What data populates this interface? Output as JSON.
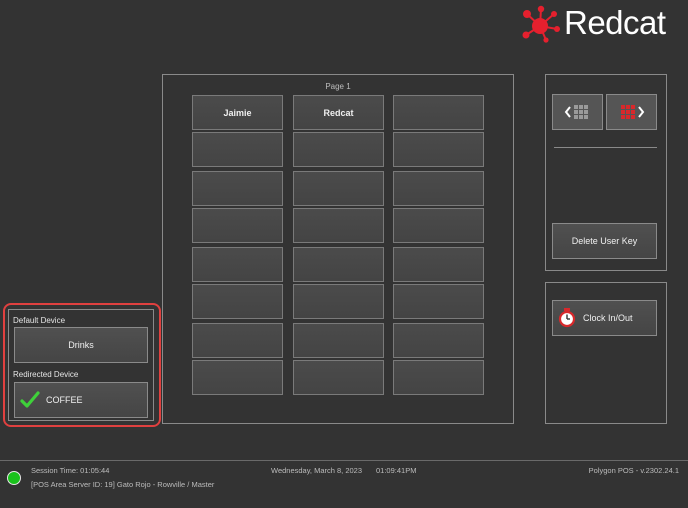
{
  "brand": {
    "name": "Redcat"
  },
  "grid": {
    "page_label": "Page 1",
    "users": [
      "Jaimie",
      "Redcat"
    ]
  },
  "nav": {
    "prev_icon": "chevron-left-grid-icon",
    "next_icon": "grid-chevron-right-icon",
    "delete_user_key_label": "Delete User Key"
  },
  "clock": {
    "label": "Clock In/Out",
    "icon": "stopwatch-icon"
  },
  "device": {
    "default_label": "Default Device",
    "default_value": "Drinks",
    "redirected_label": "Redirected Device",
    "redirected_value": "COFFEE"
  },
  "status": {
    "session_time": "Session Time: 01:05:44",
    "server_info": "[POS Area Server ID: 19] Gato Rojo - Rowville / Master",
    "date": "Wednesday, March 8, 2023",
    "time": "01:09:41PM",
    "version": "Polygon POS - v.2302.24.1",
    "connection_color": "#19c21c"
  },
  "colors": {
    "background": "#333333",
    "accent": "#e0403f",
    "logo_red": "#e5202e"
  }
}
